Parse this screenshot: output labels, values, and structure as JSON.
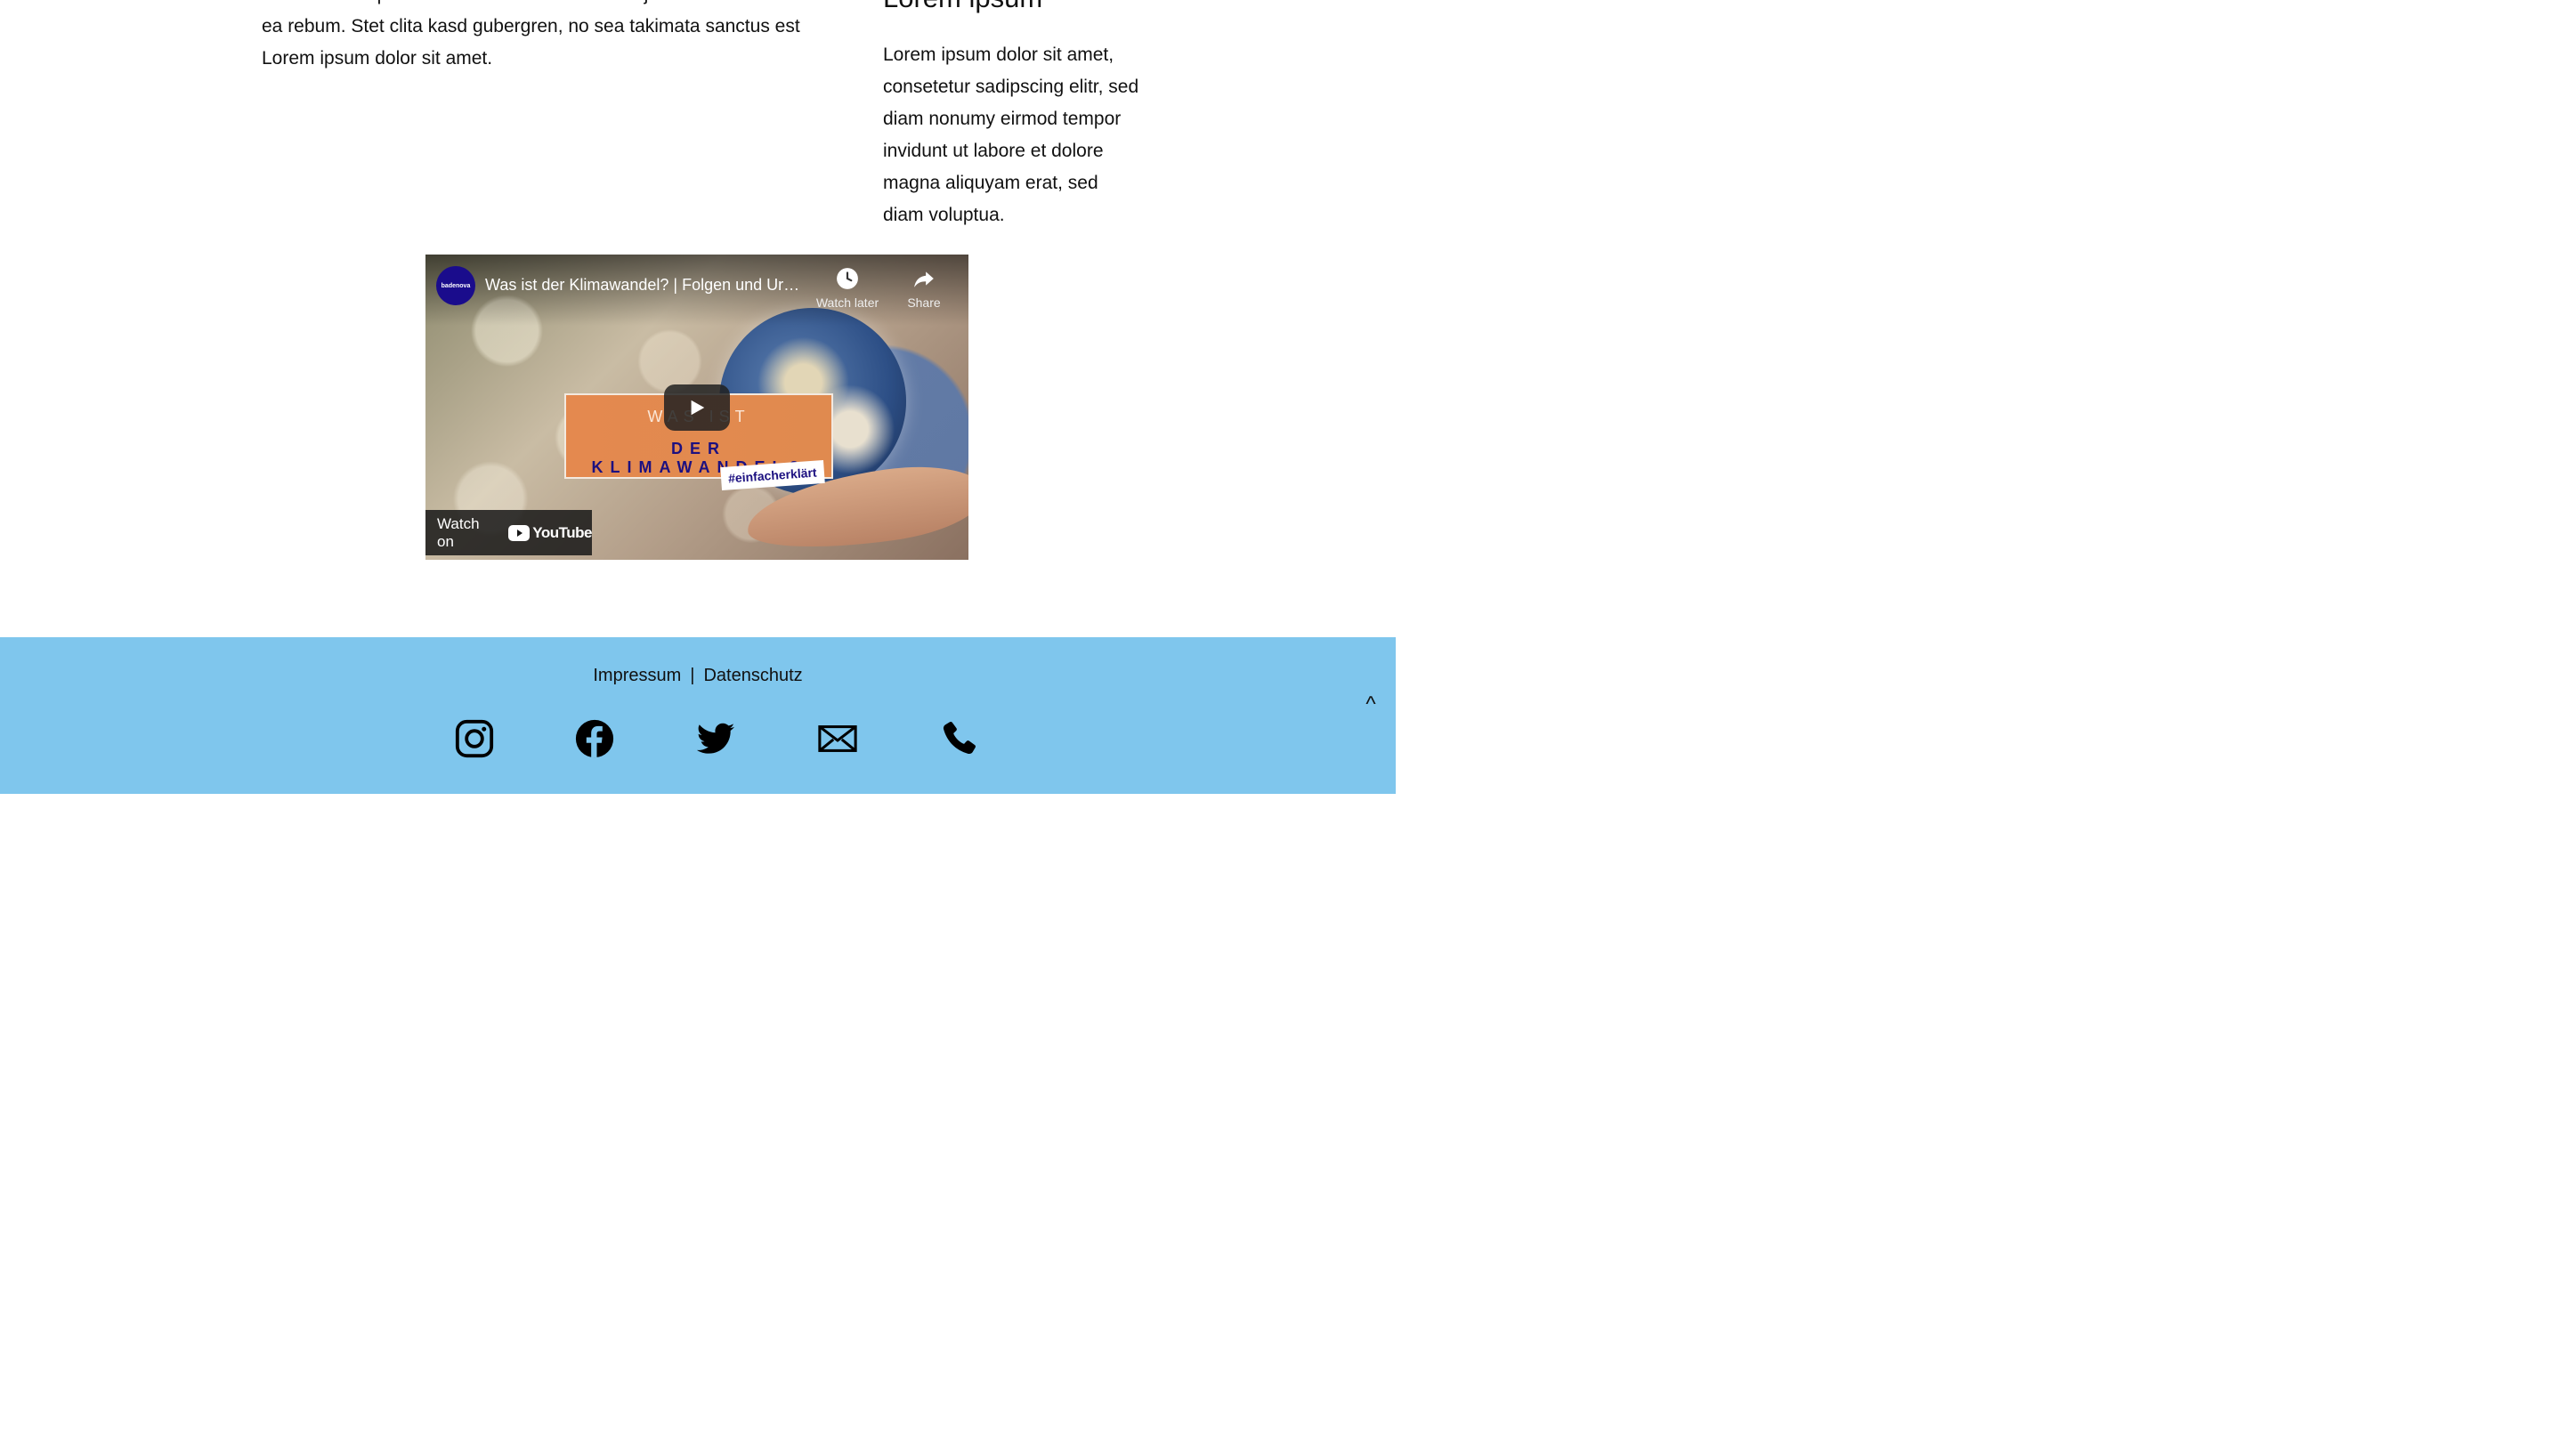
{
  "content": {
    "left_paragraph": "sed diam voluptua. At vero eos et accusam et justo duo dolores et ea rebum. Stet clita kasd gubergren, no sea takimata sanctus est Lorem ipsum dolor sit amet.",
    "right_heading": "Lorem ipsum",
    "right_paragraph": "Lorem ipsum dolor sit amet, consetetur sadipscing elitr, sed diam nonumy eirmod tempor invidunt ut labore et dolore magna aliquyam erat, sed diam voluptua."
  },
  "video": {
    "channel_logo_text": "badenova",
    "title": "Was ist der Klimawandel? | Folgen und Ursachen",
    "watch_later_label": "Watch later",
    "share_label": "Share",
    "thumbnail_top_text": "WAS IST",
    "thumbnail_main_text": "DER KLIMAWANDEL?",
    "thumbnail_hashtag": "#einfacherklärt",
    "watch_on_label": "Watch on",
    "youtube_wordmark": "YouTube"
  },
  "footer": {
    "impressum": "Impressum",
    "separator": "|",
    "datenschutz": "Datenschutz",
    "back_to_top": "^",
    "social_icons": [
      "instagram-icon",
      "facebook-icon",
      "twitter-icon",
      "mail-icon",
      "phone-icon"
    ],
    "background_color": "#7fc6ed"
  }
}
